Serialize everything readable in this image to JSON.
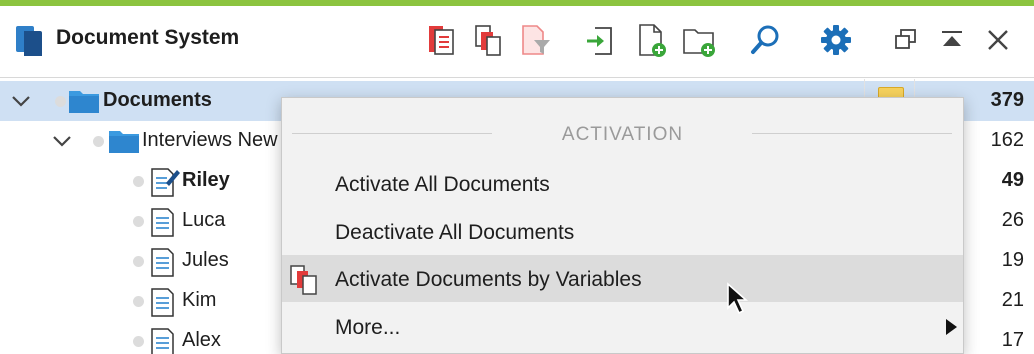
{
  "app": {
    "title": "Document System",
    "accent_color": "#8cc43f"
  },
  "toolbar": {
    "icons": [
      "activate-documents-icon",
      "activate-by-variables-icon",
      "filter-documents-icon",
      "import-icon",
      "new-document-icon",
      "new-document-set-icon",
      "search-icon",
      "settings-gear-icon"
    ],
    "window_controls": [
      "undock-window-icon",
      "collapse-pane-icon",
      "close-icon"
    ]
  },
  "tree": {
    "rows": [
      {
        "label": "Documents",
        "count": "379",
        "bold": true,
        "type": "folder"
      },
      {
        "label": "Interviews New York",
        "count": "162",
        "bold": false,
        "type": "folder"
      },
      {
        "label": "Riley",
        "count": "49",
        "bold": true,
        "type": "document-edit"
      },
      {
        "label": "Luca",
        "count": "26",
        "bold": false,
        "type": "document"
      },
      {
        "label": "Jules",
        "count": "19",
        "bold": false,
        "type": "document"
      },
      {
        "label": "Kim",
        "count": "21",
        "bold": false,
        "type": "document"
      },
      {
        "label": "Alex",
        "count": "17",
        "bold": false,
        "type": "document"
      }
    ]
  },
  "context_menu": {
    "section_title": "ACTIVATION",
    "items": [
      {
        "label": "Activate All Documents"
      },
      {
        "label": "Deactivate All Documents"
      },
      {
        "label": "Activate Documents by Variables"
      },
      {
        "label": "More..."
      }
    ]
  }
}
